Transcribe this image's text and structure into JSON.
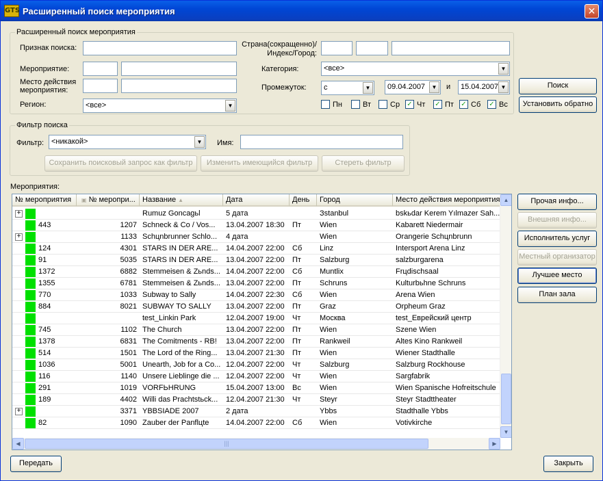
{
  "window": {
    "title": "Расширенный поиск мероприятия",
    "icon_text": "GTS",
    "close_glyph": "✕"
  },
  "search": {
    "group_label": "Расширенный поиск мероприятия",
    "feature_label": "Признак поиска:",
    "feature_value": "",
    "event_label": "Мероприятие:",
    "venue_label_1": "Место действия",
    "venue_label_2": "мероприятия:",
    "region_label": "Регион:",
    "region_value": "<все>",
    "country_label_1": "Страна(сокращенно)/",
    "country_label_2": "Индекс/Город:",
    "category_label": "Категория:",
    "category_value": "<все>",
    "period_label": "Промежуток:",
    "period_mode": "с",
    "date_from": "09.04.2007",
    "and_label": "и",
    "date_to": "15.04.2007",
    "days": [
      {
        "label": "Пн",
        "checked": false
      },
      {
        "label": "Вт",
        "checked": false
      },
      {
        "label": "Ср",
        "checked": false
      },
      {
        "label": "Чт",
        "checked": true
      },
      {
        "label": "Пт",
        "checked": true
      },
      {
        "label": "Сб",
        "checked": true
      },
      {
        "label": "Вс",
        "checked": true
      }
    ]
  },
  "actions": {
    "search": "Поиск",
    "reset": "Установить обратно"
  },
  "filter": {
    "group_label": "Фильтр поиска",
    "filter_label": "Фильтр:",
    "filter_value": "<никакой>",
    "name_label": "Имя:",
    "name_value": "",
    "save_btn": "Сохранить поисковый запрос как фильтр",
    "change_btn": "Изменить имеющийся фильтр",
    "delete_btn": "Стереть фильтр"
  },
  "events": {
    "label": "Мероприятия:",
    "columns": [
      "№ мероприятия",
      "№ меропри...",
      "Название",
      "Дата",
      "День",
      "Город",
      "Место действия мероприятия"
    ],
    "rows": [
      {
        "expand": true,
        "id1": "",
        "id2": "",
        "name": "Rumuz Goncagьl",
        "date": "5 дата",
        "day": "",
        "city": "Зstanbul",
        "venue": "bskьdar Kerem Yılmazer Sah..."
      },
      {
        "expand": false,
        "id1": "443",
        "id2": "1207",
        "name": "Schneck & Co / Vos...",
        "date": "13.04.2007 18:30",
        "day": "Пт",
        "city": "Wien",
        "venue": "Kabarett Niedermair"
      },
      {
        "expand": true,
        "id1": "",
        "id2": "1133",
        "name": "Schцnbrunner Schlo...",
        "date": "4 дата",
        "day": "",
        "city": "Wien",
        "venue": "Orangerie Schцnbrunn"
      },
      {
        "expand": false,
        "id1": "124",
        "id2": "4301",
        "name": "STARS IN DER ARE...",
        "date": "14.04.2007 22:00",
        "day": "Сб",
        "city": "Linz",
        "venue": "Intersport Arena Linz"
      },
      {
        "expand": false,
        "id1": "91",
        "id2": "5035",
        "name": "STARS IN DER ARE...",
        "date": "13.04.2007 22:00",
        "day": "Пт",
        "city": "Salzburg",
        "venue": "salzburgarena"
      },
      {
        "expand": false,
        "id1": "1372",
        "id2": "6882",
        "name": "Stemmeisen & Zьnds...",
        "date": "14.04.2007 22:00",
        "day": "Сб",
        "city": "Muntlix",
        "venue": "Frцdischsaal"
      },
      {
        "expand": false,
        "id1": "1355",
        "id2": "6781",
        "name": "Stemmeisen & Zьnds...",
        "date": "13.04.2007 22:00",
        "day": "Пт",
        "city": "Schruns",
        "venue": "Kulturbьhne Schruns"
      },
      {
        "expand": false,
        "id1": "770",
        "id2": "1033",
        "name": "Subway to Sally",
        "date": "14.04.2007 22:30",
        "day": "Сб",
        "city": "Wien",
        "venue": "Arena Wien"
      },
      {
        "expand": false,
        "id1": "884",
        "id2": "8021",
        "name": "SUBWAY TO SALLY",
        "date": "13.04.2007 22:00",
        "day": "Пт",
        "city": "Graz",
        "venue": "Orpheum Graz"
      },
      {
        "expand": false,
        "id1": "",
        "id2": "",
        "name": "test_Linkin Park",
        "date": "12.04.2007 19:00",
        "day": "Чт",
        "city": "Москва",
        "venue": "test_Еврейский центр"
      },
      {
        "expand": false,
        "id1": "745",
        "id2": "1102",
        "name": "The Church",
        "date": "13.04.2007 22:00",
        "day": "Пт",
        "city": "Wien",
        "venue": "Szene Wien"
      },
      {
        "expand": false,
        "id1": "1378",
        "id2": "6831",
        "name": "The Comitments - RB!",
        "date": "13.04.2007 22:00",
        "day": "Пт",
        "city": "Rankweil",
        "venue": "Altes Kino Rankweil"
      },
      {
        "expand": false,
        "id1": "514",
        "id2": "1501",
        "name": "The Lord of the Ring...",
        "date": "13.04.2007 21:30",
        "day": "Пт",
        "city": "Wien",
        "venue": "Wiener Stadthalle"
      },
      {
        "expand": false,
        "id1": "1036",
        "id2": "5001",
        "name": "Unearth, Job for a Co...",
        "date": "12.04.2007 22:00",
        "day": "Чт",
        "city": "Salzburg",
        "venue": "Salzburg Rockhouse"
      },
      {
        "expand": false,
        "id1": "116",
        "id2": "1140",
        "name": "Unsere Lieblinge die ...",
        "date": "12.04.2007 22:00",
        "day": "Чт",
        "city": "Wien",
        "venue": "Sargfabrik"
      },
      {
        "expand": false,
        "id1": "291",
        "id2": "1019",
        "name": "VORFЬHRUNG",
        "date": "15.04.2007 13:00",
        "day": "Вс",
        "city": "Wien",
        "venue": "Wien Spanische Hofreitschule"
      },
      {
        "expand": false,
        "id1": "189",
        "id2": "4402",
        "name": "Willi das Prachtstьck...",
        "date": "12.04.2007 21:30",
        "day": "Чт",
        "city": "Steyr",
        "venue": "Steyr Stadttheater"
      },
      {
        "expand": true,
        "id1": "",
        "id2": "3371",
        "name": "YBBSIADE 2007",
        "date": "2 дата",
        "day": "",
        "city": "Ybbs",
        "venue": "Stadthalle Ybbs"
      },
      {
        "expand": false,
        "id1": "82",
        "id2": "1090",
        "name": "Zauber der Panflцte",
        "date": "14.04.2007 22:00",
        "day": "Сб",
        "city": "Wien",
        "venue": "Votivkirche"
      }
    ]
  },
  "side_buttons": {
    "other_info": "Прочая инфо...",
    "external_info": "Внешняя инфо...",
    "service_provider": "Исполнитель услуг",
    "local_organizer": "Местный организатор",
    "best_seat": "Лучшее место",
    "hall_plan": "План зала"
  },
  "footer": {
    "transfer": "Передать",
    "close": "Закрыть"
  },
  "colors": {
    "title_bar": "#0a5fe8",
    "status_green": "#00e000",
    "face": "#ece9d8"
  }
}
